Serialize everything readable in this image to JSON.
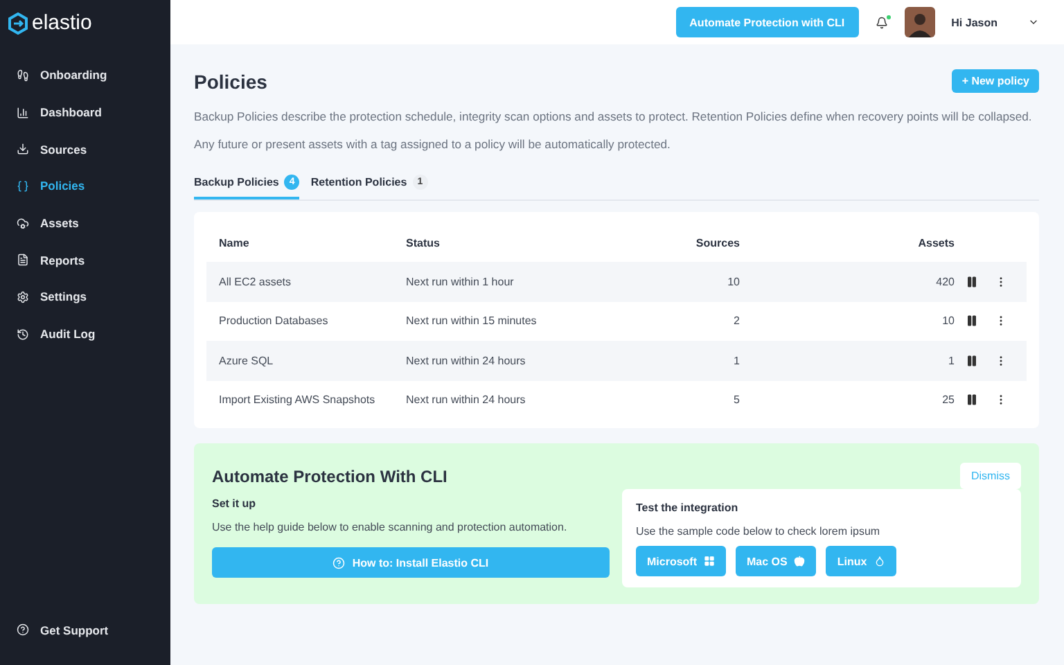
{
  "brand": "elastio",
  "sidebar": {
    "items": [
      {
        "label": "Onboarding",
        "selected": false
      },
      {
        "label": "Dashboard",
        "selected": false
      },
      {
        "label": "Sources",
        "selected": false
      },
      {
        "label": "Policies",
        "selected": true
      },
      {
        "label": "Assets",
        "selected": false
      },
      {
        "label": "Reports",
        "selected": false
      },
      {
        "label": "Settings",
        "selected": false
      },
      {
        "label": "Audit Log",
        "selected": false
      }
    ],
    "footer": "Get Support"
  },
  "topbar": {
    "cta": "Automate Protection with CLI",
    "notification": true,
    "greeting": "Hi Jason"
  },
  "page": {
    "title": "Policies",
    "new_button": "+ New policy",
    "description": [
      "Backup Policies describe the protection schedule, integrity scan options and assets to protect. Retention Policies define when recovery points will be collapsed.",
      "Any future or present assets with a tag assigned to a policy will be automatically protected."
    ]
  },
  "tabs": [
    {
      "label": "Backup Policies",
      "count": "4",
      "selected": true
    },
    {
      "label": "Retention Policies",
      "count": "1",
      "selected": false
    }
  ],
  "table": {
    "columns": [
      "Name",
      "Status",
      "Sources",
      "Assets"
    ],
    "rows": [
      {
        "name": "All EC2 assets",
        "status": "Next run within 1 hour",
        "sources": "10",
        "assets": "420"
      },
      {
        "name": "Production Databases",
        "status": "Next run within 15 minutes",
        "sources": "2",
        "assets": "10"
      },
      {
        "name": "Azure SQL",
        "status": "Next run within 24 hours",
        "sources": "1",
        "assets": "1"
      },
      {
        "name": "Import Existing AWS Snapshots",
        "status": "Next run within 24 hours",
        "sources": "5",
        "assets": "25"
      }
    ]
  },
  "cli": {
    "title": "Automate Protection With CLI",
    "dismiss": "Dismiss",
    "setup_heading": "Set it up",
    "setup_text": "Use the help guide below to enable scanning and protection automation.",
    "install_button": "How to: Install Elastio CLI",
    "test_heading": "Test the integration",
    "test_text": "Use the sample code below to check lorem ipsum",
    "os_buttons": [
      {
        "label": "Microsoft"
      },
      {
        "label": "Mac OS"
      },
      {
        "label": "Linux"
      }
    ]
  }
}
